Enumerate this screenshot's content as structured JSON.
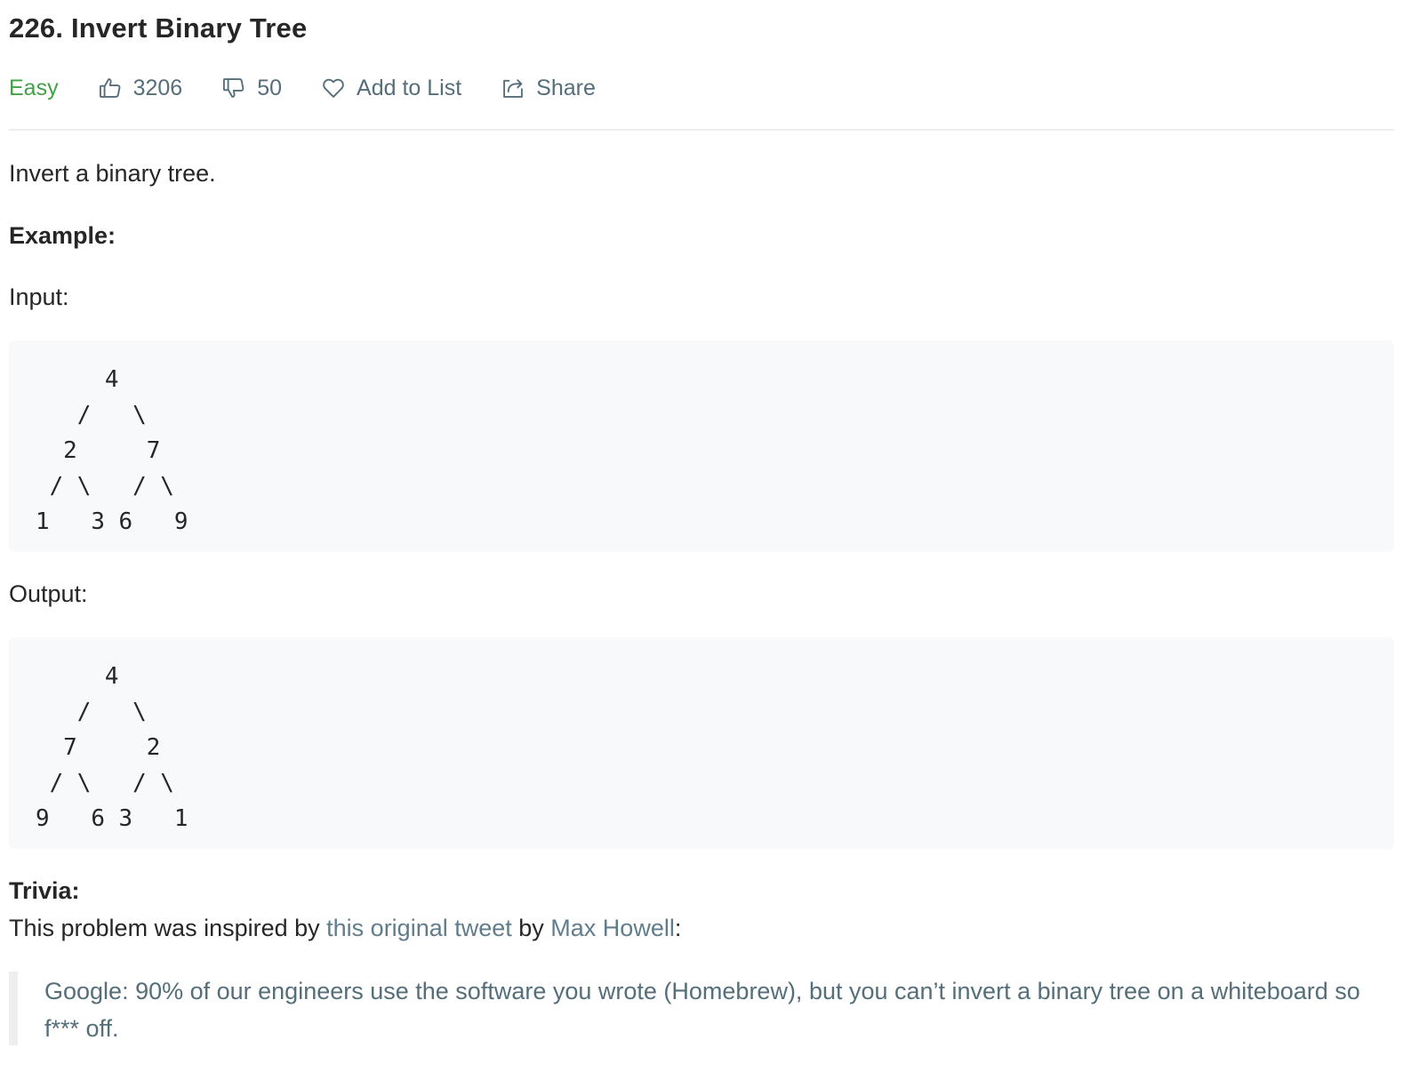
{
  "problem": {
    "title": "226. Invert Binary Tree",
    "difficulty": "Easy",
    "likes": "3206",
    "dislikes": "50",
    "add_to_list_label": "Add to List",
    "share_label": "Share"
  },
  "description": {
    "intro": "Invert a binary tree.",
    "example_heading": "Example:",
    "input_label": "Input:",
    "input_tree": "     4\n   /   \\\n  2     7\n / \\   / \\\n1   3 6   9",
    "output_label": "Output:",
    "output_tree": "     4\n   /   \\\n  7     2\n / \\   / \\\n9   6 3   1"
  },
  "trivia": {
    "heading": "Trivia:",
    "text_before": "This problem was inspired by ",
    "tweet_link": "this original tweet",
    "text_middle": " by ",
    "author_link": "Max Howell",
    "text_after": ":",
    "quote": "Google: 90% of our engineers use the software you wrote (Homebrew), but you can’t invert a binary tree on a whiteboard so f*** off."
  },
  "colors": {
    "difficulty_easy": "#43a047",
    "link": "#607d8b",
    "muted": "#546e7a",
    "code_bg": "#f7f9fa"
  },
  "icons": {
    "like": "thumbs-up-icon",
    "dislike": "thumbs-down-icon",
    "favorite": "heart-icon",
    "share": "share-icon"
  }
}
